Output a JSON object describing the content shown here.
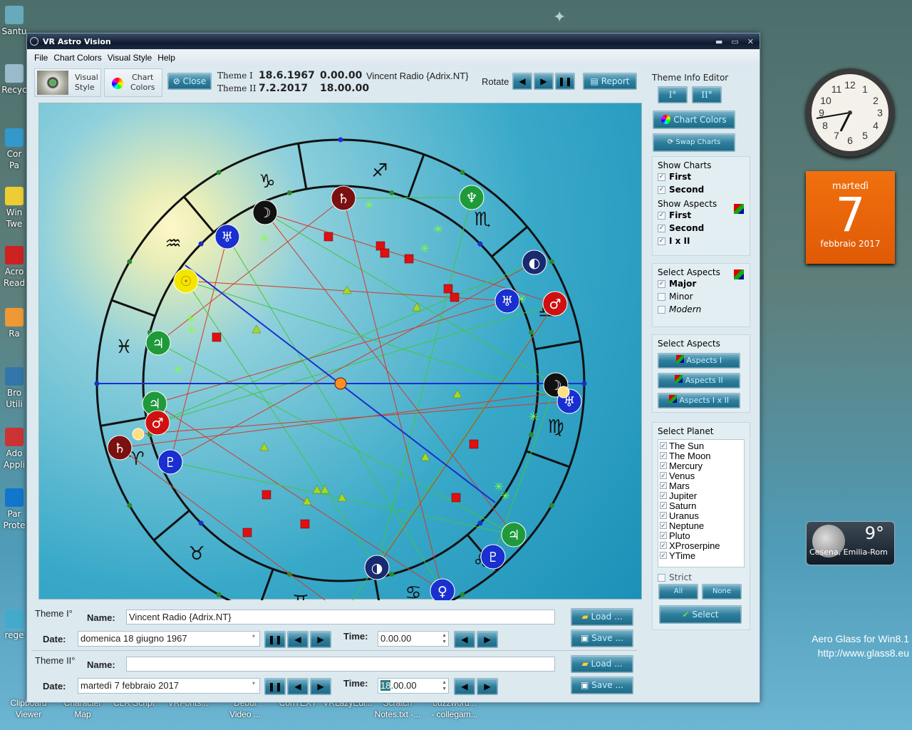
{
  "desktop": {
    "left_icons": [
      "Santu",
      "Recyc",
      "Cor\nPa",
      "Win\nTwe",
      "Acro\nRead",
      "Ra",
      "Bro\nUtili",
      "Ado\nAppli",
      "Par\nProte",
      "rege"
    ],
    "bottom_icons": [
      "Clipboard\nViewer",
      "Character\nMap",
      "CLR Script",
      "VRFonts...",
      "Debut\nVideo ...",
      "ConTEXT",
      "VRLazyEdi...",
      "Scratch\nNotes.txt -...",
      "buzzword...\n- collegam..."
    ],
    "calendar": {
      "weekday": "martedì",
      "day": "7",
      "month_year": "febbraio 2017"
    },
    "clock": {
      "time": "19:43"
    },
    "weather": {
      "temp": "9°",
      "location": "Cesena, Emilia-Rom"
    },
    "watermark": {
      "line1": "Aero Glass for Win8.1",
      "line2": "http://www.glass8.eu"
    }
  },
  "window": {
    "title": "VR Astro Vision",
    "menu": [
      "File",
      "Chart Colors",
      "Visual Style",
      "Help"
    ],
    "toolbar": {
      "visual_style": "Visual\nStyle",
      "chart_colors": "Chart\nColors",
      "close": "Close",
      "theme1_label": "Theme I",
      "theme1_date": "18.6.1967",
      "theme1_time": "0.00.00",
      "theme1_name": "Vincent Radio {Adrix.NT}",
      "theme2_label": "Theme II",
      "theme2_date": "7.2.2017",
      "theme2_time": "18.00.00",
      "rotate": "Rotate",
      "report": "Report"
    },
    "panel": {
      "theme_info_editor": "Theme Info Editor",
      "btn_i": "I°",
      "btn_ii": "II°",
      "chart_colors": "Chart Colors",
      "swap_charts": "Swap Charts",
      "show_charts": {
        "title": "Show Charts",
        "items": [
          {
            "label": "First",
            "checked": true
          },
          {
            "label": "Second",
            "checked": true
          }
        ]
      },
      "show_aspects": {
        "title": "Show Aspects",
        "items": [
          {
            "label": "First",
            "checked": true
          },
          {
            "label": "Second",
            "checked": true
          },
          {
            "label": "I x II",
            "checked": true
          }
        ]
      },
      "select_aspects": {
        "title": "Select Aspects",
        "items": [
          {
            "label": "Major",
            "checked": true
          },
          {
            "label": "Minor",
            "checked": false
          },
          {
            "label": "Modern",
            "checked": false
          }
        ]
      },
      "aspect_buttons": {
        "title": "Select Aspects",
        "items": [
          "Aspects I",
          "Aspects II",
          "Aspects I x II"
        ]
      },
      "select_planet": {
        "title": "Select Planet",
        "items": [
          "The Sun",
          "The Moon",
          "Mercury",
          "Venus",
          "Mars",
          "Jupiter",
          "Saturn",
          "Uranus",
          "Neptune",
          "Pluto",
          "XProserpine",
          "YTime"
        ]
      },
      "strict": "Strict",
      "all": "All",
      "none": "None",
      "select": "Select"
    },
    "form": {
      "theme1": {
        "title": "Theme I°",
        "name_label": "Name:",
        "name": "Vincent Radio {Adrix.NT}",
        "date_label": "Date:",
        "date": "domenica 18 giugno 1967",
        "time_label": "Time:",
        "time": "0.00.00"
      },
      "theme2": {
        "title": "Theme II°",
        "name_label": "Name:",
        "name": "",
        "date_label": "Date:",
        "date": "martedì 7 febbraio 2017",
        "time_label": "Time:",
        "time_sel": "18",
        "time_rest": ".00.00"
      },
      "load": "Load ...",
      "save": "Save ..."
    },
    "chart": {
      "signs": [
        "♑",
        "♐",
        "♏",
        "♎",
        "♍",
        "♌",
        "♋",
        "♊",
        "♉",
        "♈",
        "♓",
        "♒"
      ],
      "colors": {
        "aspect_red": "#d23a2a",
        "aspect_green": "#3fc83f",
        "axis": "#1a2fd0",
        "square": "#e01010",
        "trine": "#a8d820"
      }
    }
  }
}
